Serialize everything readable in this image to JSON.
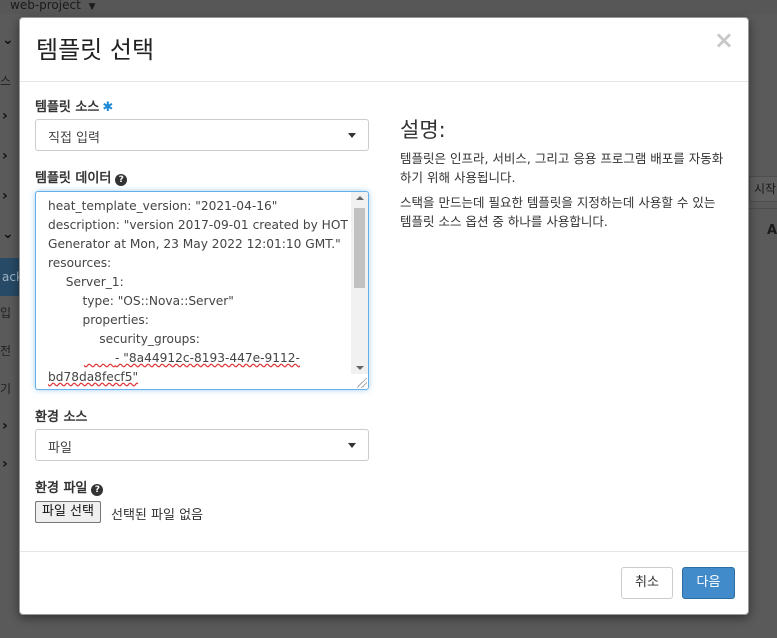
{
  "background": {
    "project_name": "web-project",
    "sidebar_fragments": [
      "스",
      "ack",
      "입",
      "전",
      "기"
    ],
    "right_button_fragment": "시작",
    "right_column_fragment": "A"
  },
  "modal": {
    "title": "템플릿 선택",
    "close_symbol": "×",
    "template_source": {
      "label": "템플릿 소스",
      "required_mark": "✱",
      "selected": "직접 입력"
    },
    "template_data": {
      "label": "템플릿 데이터",
      "help_symbol": "?",
      "lines": [
        "heat_template_version: \"2021-04-16\"",
        "description: \"version 2017-09-01 created by HOT Generator at Mon, 23 May 2022 12:01:10 GMT.\"",
        "resources:",
        "  Server_1:",
        "    type: \"OS::Nova::Server\"",
        "    properties:",
        "      security_groups:",
        "        - \"8a44912c-8193-447e-9112-bd78da8fecf5\""
      ]
    },
    "env_source": {
      "label": "환경 소스",
      "selected": "파일"
    },
    "env_file": {
      "label": "환경 파일",
      "help_symbol": "?",
      "button_label": "파일 선택",
      "status": "선택된 파일 없음"
    },
    "description": {
      "title": "설명:",
      "paragraph1": "템플릿은 인프라, 서비스, 그리고 응용 프로그램 배포를 자동화하기 위해 사용됩니다.",
      "paragraph2": "스택을 만드는데 필요한 템플릿을 지정하는데 사용할 수 있는 템플릿 소스 옵션 중 하나를 사용합니다."
    },
    "footer": {
      "cancel_label": "취소",
      "next_label": "다음"
    }
  },
  "colors": {
    "primary": "#428bca",
    "required": "#1c8ad6",
    "focus_border": "#66afe9"
  }
}
